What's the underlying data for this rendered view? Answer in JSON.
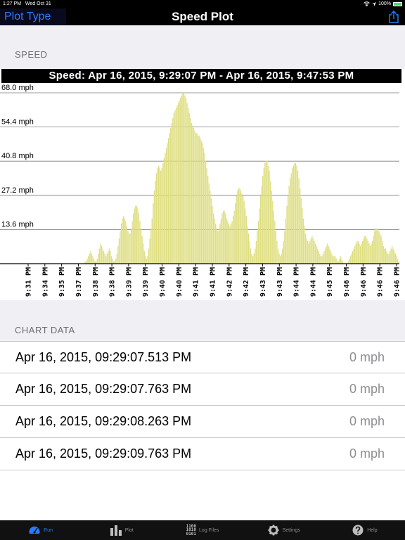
{
  "status_bar": {
    "time": "1:27 PM",
    "date": "Wed Oct 31",
    "battery": "100%"
  },
  "nav": {
    "left_button": "Plot Type",
    "title": "Speed Plot"
  },
  "sections": {
    "speed": "SPEED",
    "chart_data": "CHART DATA"
  },
  "chart_data": {
    "type": "bar",
    "title": "Speed: Apr 16, 2015, 9:29:07 PM - Apr 16, 2015, 9:47:53 PM",
    "ylim": [
      0,
      68.0
    ],
    "yticks": [
      "68.0 mph",
      "54.4 mph",
      "40.8 mph",
      "27.2 mph",
      "13.6 mph"
    ],
    "ytick_values": [
      68.0,
      54.4,
      40.8,
      27.2,
      13.6
    ],
    "xticks": [
      "9:31 PM",
      "9:34 PM",
      "9:35 PM",
      "9:37 PM",
      "9:38 PM",
      "9:38 PM",
      "9:39 PM",
      "9:39 PM",
      "9:40 PM",
      "9:40 PM",
      "9:41 PM",
      "9:41 PM",
      "9:42 PM",
      "9:42 PM",
      "9:43 PM",
      "9:43 PM",
      "9:44 PM",
      "9:44 PM",
      "9:45 PM",
      "9:46 PM",
      "9:46 PM",
      "9:46 PM",
      "9:46 PM"
    ],
    "grid": true,
    "bar_color": "#dede80",
    "values": [
      0,
      0,
      0,
      0,
      0,
      0,
      0,
      0,
      0,
      0,
      0,
      0,
      0,
      0,
      0,
      0,
      0,
      0,
      0,
      0,
      0,
      0,
      0,
      0,
      0,
      0,
      0,
      0,
      0,
      0,
      0,
      0,
      0,
      0,
      0,
      0,
      0,
      0,
      0,
      0,
      0,
      0,
      0,
      0,
      0,
      0,
      0,
      0,
      0,
      0,
      0,
      0,
      0,
      0,
      0,
      0,
      0,
      0,
      1,
      1,
      2,
      3,
      4,
      5,
      4,
      3,
      2,
      1,
      1,
      2,
      4,
      6,
      8,
      7,
      6,
      5,
      4,
      3,
      4,
      5,
      6,
      5,
      3,
      2,
      1,
      1,
      2,
      4,
      7,
      10,
      13,
      16,
      18,
      19,
      18,
      17,
      15,
      13,
      12,
      12,
      14,
      17,
      20,
      22,
      23,
      23,
      22,
      20,
      17,
      14,
      11,
      8,
      5,
      3,
      2,
      3,
      6,
      10,
      14,
      18,
      24,
      29,
      33,
      36,
      38,
      39,
      38,
      37,
      38,
      40,
      42,
      44,
      46,
      48,
      50,
      52,
      54,
      56,
      58,
      60,
      61,
      62,
      63,
      64,
      65,
      66,
      67,
      68,
      68,
      67,
      66,
      64,
      62,
      60,
      58,
      56,
      55,
      54,
      53,
      52,
      52,
      51,
      51,
      50,
      49,
      48,
      46,
      44,
      41,
      38,
      35,
      32,
      29,
      26,
      23,
      20,
      18,
      16,
      14,
      13,
      14,
      16,
      18,
      20,
      21,
      21,
      20,
      18,
      17,
      16,
      15,
      16,
      17,
      19,
      21,
      24,
      27,
      29,
      30,
      30,
      29,
      28,
      27,
      25,
      22,
      19,
      15,
      12,
      9,
      6,
      4,
      3,
      4,
      6,
      9,
      13,
      17,
      22,
      27,
      31,
      35,
      38,
      40,
      41,
      41,
      39,
      37,
      33,
      29,
      25,
      21,
      17,
      13,
      9,
      6,
      4,
      3,
      4,
      6,
      9,
      13,
      18,
      23,
      27,
      31,
      34,
      36,
      38,
      39,
      40,
      40,
      39,
      37,
      34,
      30,
      26,
      22,
      18,
      15,
      12,
      10,
      9,
      8,
      9,
      10,
      11,
      10,
      9,
      8,
      7,
      6,
      5,
      4,
      3,
      3,
      4,
      5,
      6,
      7,
      8,
      7,
      6,
      5,
      4,
      3,
      3,
      3,
      2,
      1,
      1,
      2,
      3,
      2,
      1,
      0,
      0,
      0,
      0,
      1,
      2,
      3,
      4,
      5,
      6,
      7,
      8,
      9,
      9,
      8,
      7,
      8,
      9,
      10,
      11,
      11,
      10,
      9,
      8,
      7,
      8,
      9,
      11,
      13,
      14,
      14,
      14,
      13,
      12,
      11,
      9,
      7,
      6,
      6,
      5,
      4,
      4,
      5,
      6,
      7,
      6,
      5,
      4,
      3,
      2,
      1
    ]
  },
  "table": {
    "rows": [
      {
        "timestamp": "Apr 16, 2015, 09:29:07.513 PM",
        "value": "0 mph"
      },
      {
        "timestamp": "Apr 16, 2015, 09:29:07.763 PM",
        "value": "0 mph"
      },
      {
        "timestamp": "Apr 16, 2015, 09:29:08.263 PM",
        "value": "0 mph"
      },
      {
        "timestamp": "Apr 16, 2015, 09:29:09.763 PM",
        "value": "0 mph"
      }
    ]
  },
  "tabs": [
    {
      "label": "Run",
      "icon": "speedometer-icon",
      "active": true
    },
    {
      "label": "Plot",
      "icon": "bar-chart-icon",
      "active": false
    },
    {
      "label": "Log Files",
      "icon": "binary-icon",
      "active": false,
      "icon_text": [
        "1100",
        "1010",
        "0101"
      ]
    },
    {
      "label": "Settings",
      "icon": "gear-icon",
      "active": false
    },
    {
      "label": "Help",
      "icon": "help-icon",
      "active": false
    }
  ]
}
